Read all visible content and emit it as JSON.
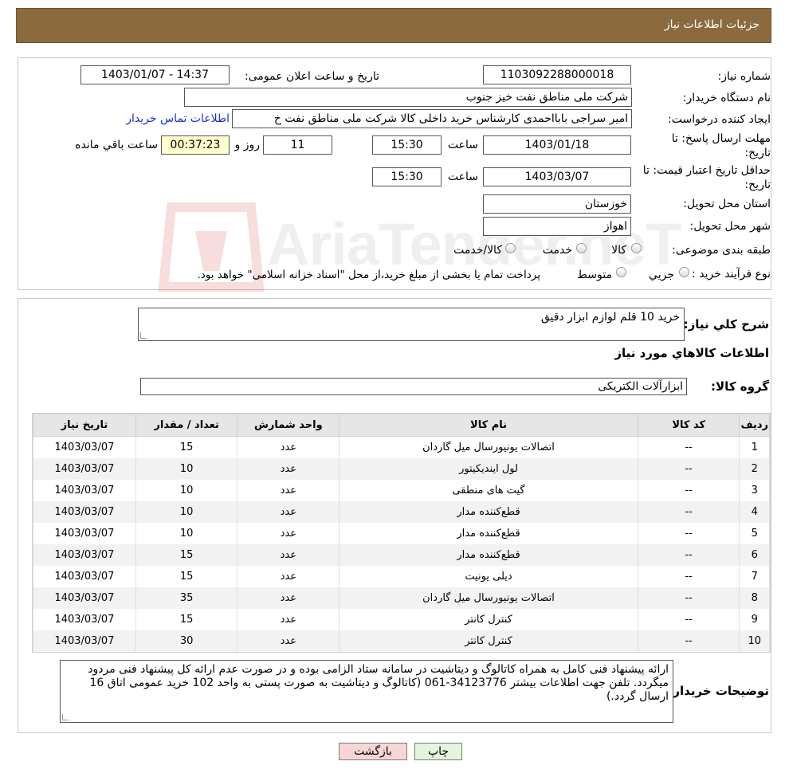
{
  "header": {
    "title": "جزئیات اطلاعات نیاز"
  },
  "form": {
    "need_number_label": "شماره نیاز:",
    "need_number": "1103092288000018",
    "announce_label": "تاریخ و ساعت اعلان عمومی:",
    "announce_value": "1403/01/07 - 14:37",
    "buyer_org_label": "نام دستگاه خریدار:",
    "buyer_org": "شرکت ملی مناطق نفت خیز جنوب",
    "creator_label": "ایجاد کننده درخواست:",
    "creator": "امیر  سراجی بابااحمدی  کارشناس خرید داخلی کالا شرکت ملی مناطق نفت خ",
    "contact_link": "اطلاعات تماس خریدار",
    "deadline_label_1": "مهلت ارسال پاسخ: تا",
    "deadline_label_2": "تاریخ:",
    "deadline_date": "1403/01/18",
    "time_label": "ساعت",
    "deadline_time": "15:30",
    "days_value": "11",
    "days_label": "روز و",
    "remaining_time": "00:37:23",
    "remaining_label": "ساعت باقي مانده",
    "price_valid_label_1": "حداقل تاریخ اعتبار قیمت: تا",
    "price_valid_label_2": "تاریخ:",
    "price_valid_date": "1403/03/07",
    "price_valid_time": "15:30",
    "province_label": "استان محل تحویل:",
    "province": "خوزستان",
    "city_label": "شهر محل تحویل:",
    "city": "اهواز",
    "category_label": "طبقه بندی موضوعی:",
    "category_options": [
      "کالا",
      "خدمت",
      "کالا/خدمت"
    ],
    "process_label": "نوع فرآیند خرید :",
    "process_options": [
      "جزيي",
      "متوسط"
    ],
    "process_note": "پرداخت تمام یا بخشی از مبلغ خرید،از محل \"اسناد خزانه اسلامی\" خواهد بود."
  },
  "watermark": {
    "text": "AriaTender.neT"
  },
  "details": {
    "summary_label": "شرح کلي نياز:",
    "summary": "خرید 10 قلم لوازم ابزار دقیق",
    "items_heading": "اطلاعات کالاهاي مورد نياز",
    "group_label": "گروه کالا:",
    "group": "ابزارآلات الکتریکی"
  },
  "table": {
    "headers": [
      "رديف",
      "کد کالا",
      "نام کالا",
      "واحد شمارش",
      "تعداد / مقدار",
      "تاریخ نیاز"
    ],
    "rows": [
      [
        "1",
        "--",
        "اتصالات یونیورسال میل گاردان",
        "عدد",
        "15",
        "1403/03/07"
      ],
      [
        "2",
        "--",
        "لول اینديکیتور",
        "عدد",
        "10",
        "1403/03/07"
      ],
      [
        "3",
        "--",
        "گیت های منطقی",
        "عدد",
        "10",
        "1403/03/07"
      ],
      [
        "4",
        "--",
        "قطع‌کننده مدار",
        "عدد",
        "10",
        "1403/03/07"
      ],
      [
        "5",
        "--",
        "قطع‌کننده مدار",
        "عدد",
        "10",
        "1403/03/07"
      ],
      [
        "6",
        "--",
        "قطع‌کننده مدار",
        "عدد",
        "15",
        "1403/03/07"
      ],
      [
        "7",
        "--",
        "دیلی یونیت",
        "عدد",
        "15",
        "1403/03/07"
      ],
      [
        "8",
        "--",
        "اتصالات یونیورسال میل گاردان",
        "عدد",
        "35",
        "1403/03/07"
      ],
      [
        "9",
        "--",
        "کنترل کانتر",
        "عدد",
        "15",
        "1403/03/07"
      ],
      [
        "10",
        "--",
        "کنترل کانتر",
        "عدد",
        "30",
        "1403/03/07"
      ]
    ]
  },
  "notes": {
    "label": "توضیحات خریدار:",
    "text": "ارائه پیشنهاد فنی کامل به همراه کاتالوگ و دیتاشیت در سامانه ستاد الزامی بوده و در صورت عدم ارائه کل پیشنهاد فنی مردود میگردد. تلفن جهت اطلاعات بیشتر 34123776-061  (کاتالوگ و دیتاشیت به صورت پستی به واحد 102 خرید عمومی اتاق 16 ارسال گردد.)"
  },
  "buttons": {
    "print": "چاپ",
    "back": "بازگشت"
  },
  "colors": {
    "header": "#8b6b3e",
    "link": "#1a2fd6",
    "back_button": "#f9d6d6",
    "print_button": "#e3f5dc",
    "remaining_box": "#ffffcc"
  }
}
